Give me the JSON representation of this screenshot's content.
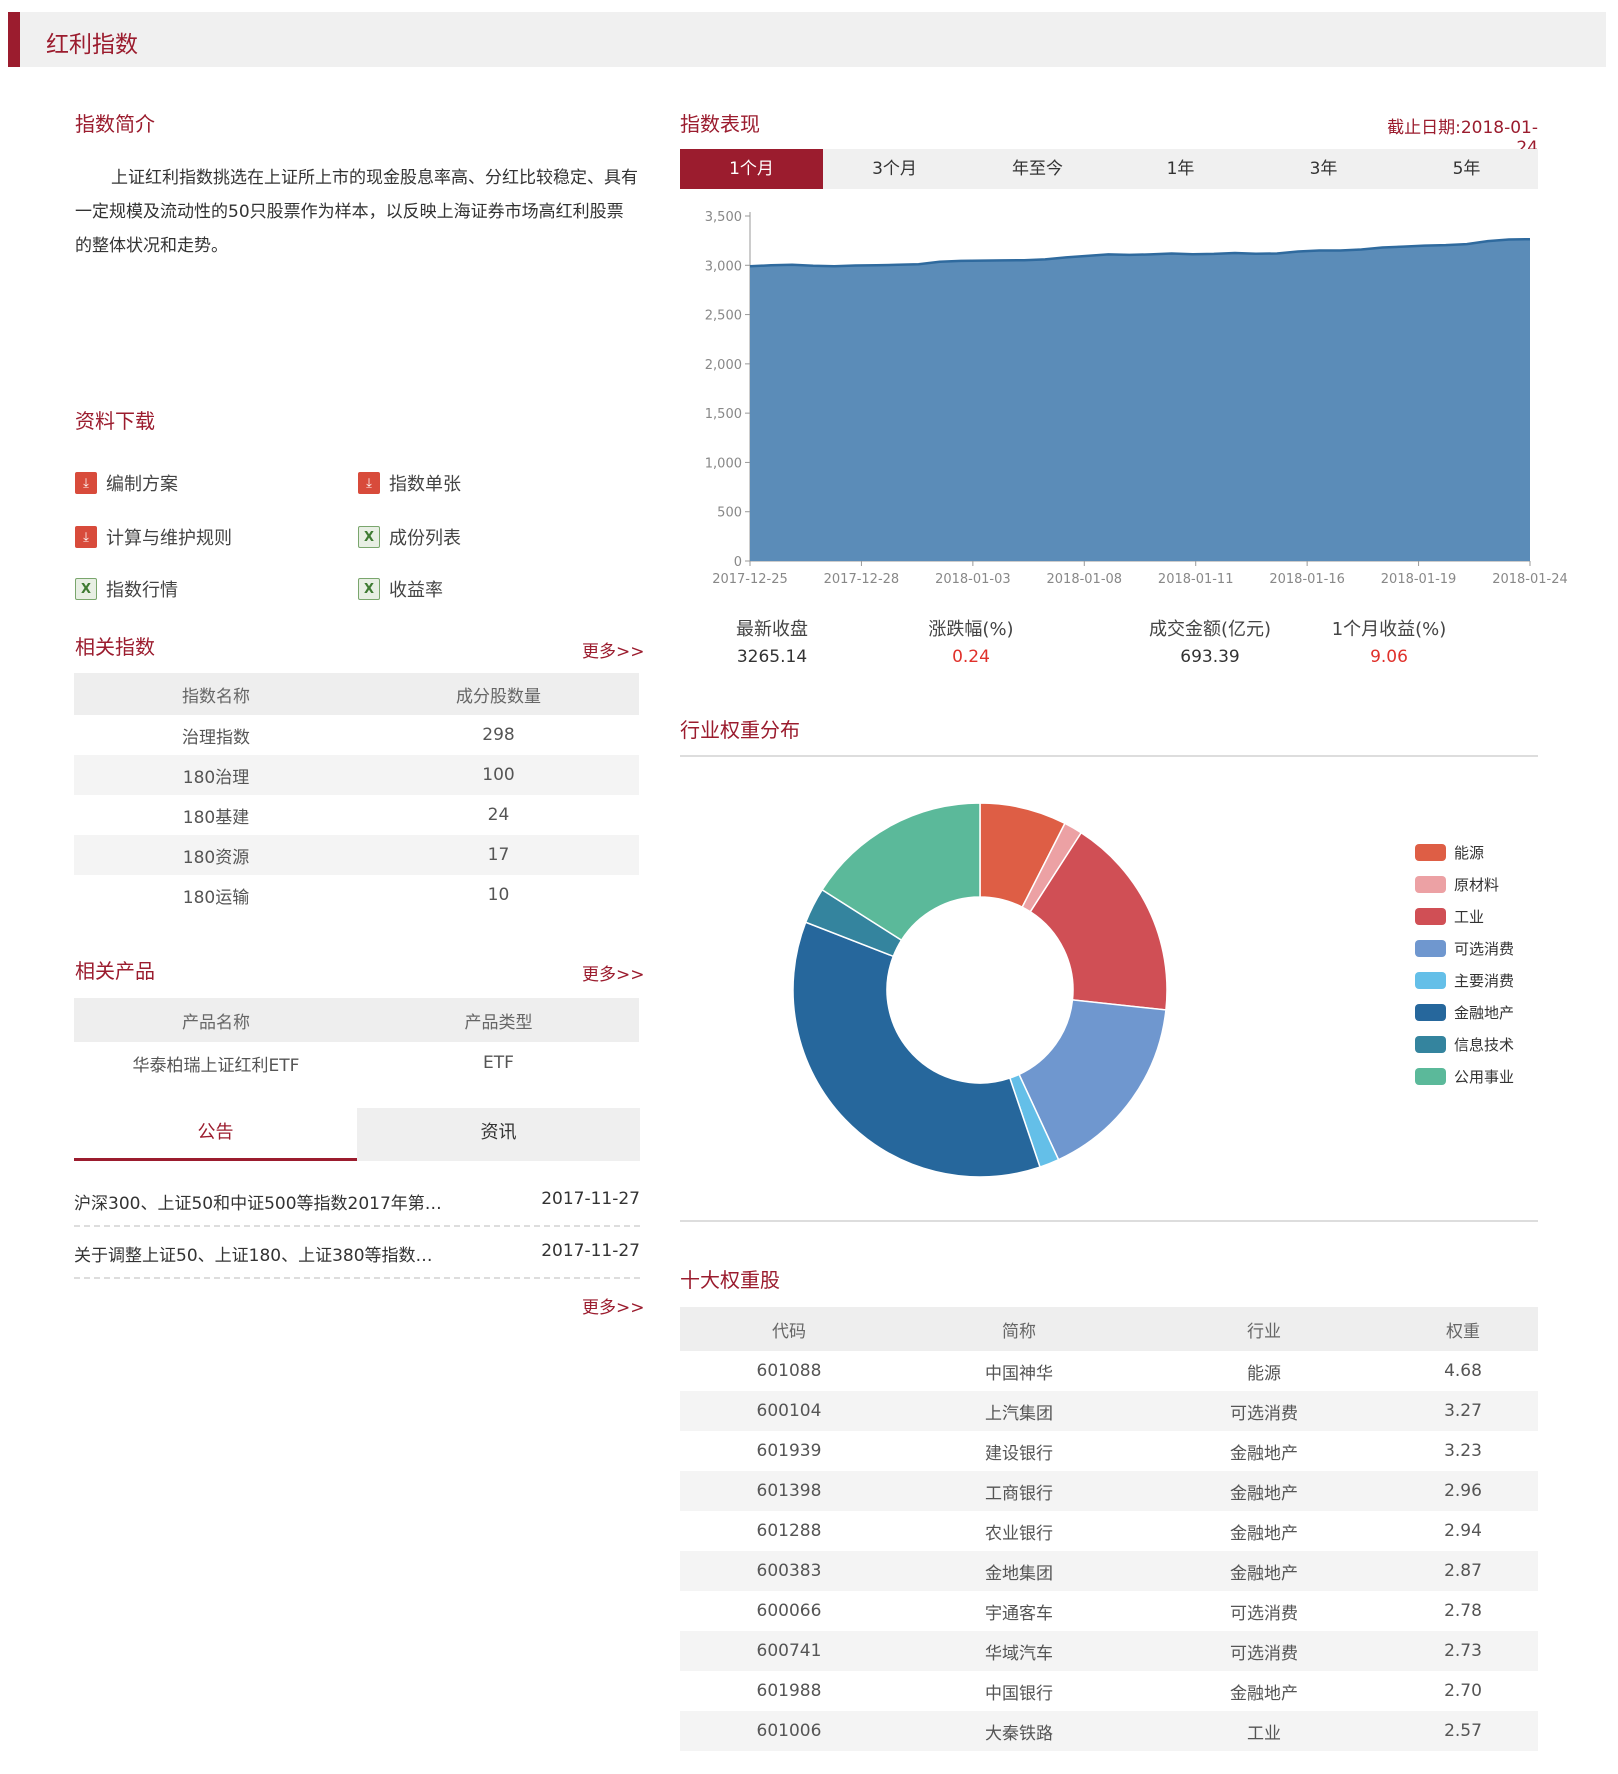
{
  "header": {
    "title": "红利指数"
  },
  "intro": {
    "title": "指数简介",
    "text": "上证红利指数挑选在上证所上市的现金股息率高、分红比较稳定、具有一定规模及流动性的50只股票作为样本，以反映上海证券市场高红利股票的整体状况和走势。"
  },
  "downloads": {
    "title": "资料下载",
    "items": [
      {
        "label": "编制方案",
        "icon": "pdf-icon"
      },
      {
        "label": "指数单张",
        "icon": "pdf-icon"
      },
      {
        "label": "计算与维护规则",
        "icon": "pdf-icon"
      },
      {
        "label": "成份列表",
        "icon": "excel-icon"
      },
      {
        "label": "指数行情",
        "icon": "excel-icon"
      },
      {
        "label": "收益率",
        "icon": "excel-icon"
      }
    ]
  },
  "related_index": {
    "title": "相关指数",
    "more": "更多>>",
    "headers": [
      "指数名称",
      "成分股数量"
    ],
    "rows": [
      [
        "治理指数",
        "298"
      ],
      [
        "180治理",
        "100"
      ],
      [
        "180基建",
        "24"
      ],
      [
        "180资源",
        "17"
      ],
      [
        "180运输",
        "10"
      ]
    ]
  },
  "related_products": {
    "title": "相关产品",
    "more": "更多>>",
    "headers": [
      "产品名称",
      "产品类型"
    ],
    "rows": [
      [
        "华泰柏瑞上证红利ETF",
        "ETF"
      ]
    ]
  },
  "news": {
    "tabs": [
      "公告",
      "资讯"
    ],
    "active_tab": 0,
    "items": [
      {
        "title": "沪深300、上证50和中证500等指数2017年第…",
        "date": "2017-11-27"
      },
      {
        "title": "关于调整上证50、上证180、上证380等指数…",
        "date": "2017-11-27"
      }
    ],
    "more": "更多>>"
  },
  "performance": {
    "title": "指数表现",
    "cutoff": "截止日期:2018-01-24",
    "tabs": [
      "1个月",
      "3个月",
      "年至今",
      "1年",
      "3年",
      "5年"
    ],
    "active_tab": 0,
    "stats": [
      {
        "label": "最新收盘",
        "value": "3265.14",
        "color": "#333333"
      },
      {
        "label": "涨跌幅(%)",
        "value": "0.24",
        "color": "#e0312b"
      },
      {
        "label": "成交金额(亿元)",
        "value": "693.39",
        "color": "#333333"
      },
      {
        "label": "1个月收益(%)",
        "value": "9.06",
        "color": "#e0312b"
      }
    ]
  },
  "chart_data": [
    {
      "type": "area",
      "title": "",
      "x_ticks": [
        "2017-12-25",
        "2017-12-28",
        "2018-01-03",
        "2018-01-08",
        "2018-01-11",
        "2018-01-16",
        "2018-01-19",
        "2018-01-24"
      ],
      "y_ticks": [
        "0",
        "500",
        "1,000",
        "1,500",
        "2,000",
        "2,500",
        "3,000",
        "3,500"
      ],
      "ylim": [
        0,
        3500
      ],
      "color": "#5b8cb8",
      "line_color": "#2f6a9e",
      "values": [
        2990,
        3000,
        3005,
        2995,
        2990,
        2998,
        3000,
        3005,
        3010,
        3035,
        3045,
        3048,
        3050,
        3052,
        3060,
        3080,
        3095,
        3110,
        3105,
        3110,
        3120,
        3112,
        3115,
        3125,
        3118,
        3120,
        3140,
        3150,
        3150,
        3160,
        3180,
        3190,
        3200,
        3205,
        3215,
        3245,
        3262,
        3265
      ]
    },
    {
      "type": "pie",
      "title": "行业权重分布",
      "categories": [
        "能源",
        "原材料",
        "工业",
        "可选消费",
        "主要消费",
        "金融地产",
        "信息技术",
        "公用事业"
      ],
      "values": [
        7.5,
        1.6,
        17.6,
        16.4,
        1.7,
        36.1,
        3.1,
        16.0
      ],
      "colors": [
        "#de5e45",
        "#eca1a4",
        "#d04f55",
        "#6f97cf",
        "#64bfe8",
        "#26679c",
        "#34849e",
        "#5bb99a"
      ]
    }
  ],
  "top10": {
    "title": "十大权重股",
    "headers": [
      "代码",
      "简称",
      "行业",
      "权重"
    ],
    "rows": [
      [
        "601088",
        "中国神华",
        "能源",
        "4.68"
      ],
      [
        "600104",
        "上汽集团",
        "可选消费",
        "3.27"
      ],
      [
        "601939",
        "建设银行",
        "金融地产",
        "3.23"
      ],
      [
        "601398",
        "工商银行",
        "金融地产",
        "2.96"
      ],
      [
        "601288",
        "农业银行",
        "金融地产",
        "2.94"
      ],
      [
        "600383",
        "金地集团",
        "金融地产",
        "2.87"
      ],
      [
        "600066",
        "宇通客车",
        "可选消费",
        "2.78"
      ],
      [
        "600741",
        "华域汽车",
        "可选消费",
        "2.73"
      ],
      [
        "601988",
        "中国银行",
        "金融地产",
        "2.70"
      ],
      [
        "601006",
        "大秦铁路",
        "工业",
        "2.57"
      ]
    ]
  }
}
